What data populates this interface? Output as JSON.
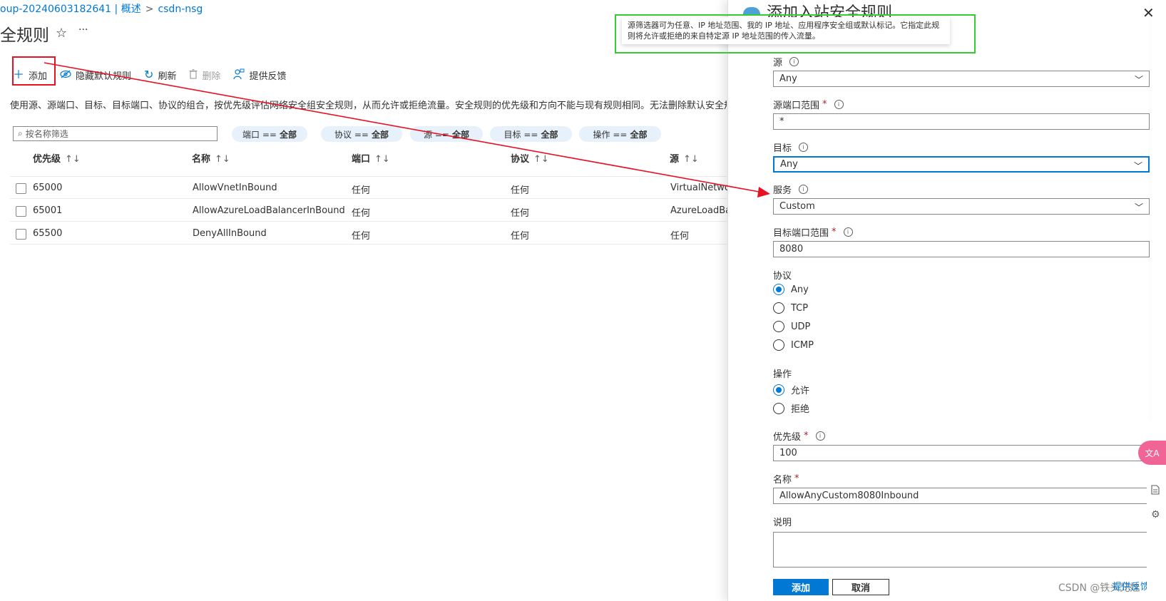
{
  "breadcrumb": {
    "part1": "oup-20240603182641 | 概述",
    "sep": ">",
    "part2": "csdn-nsg"
  },
  "page": {
    "title": "全规则",
    "star_icon": "☆",
    "more_icon": "···"
  },
  "toolbar": {
    "add": "添加",
    "hide_defaults": "隐藏默认规则",
    "refresh": "刷新",
    "delete": "删除",
    "feedback": "提供反馈"
  },
  "description": "使用源、源端口、目标、目标端口、协议的组合，按优先级评估网络安全组安全规则，从而允许或拒绝流量。安全规则的优先级和方向不能与现有规则相同。无法删除默认安全规则，但",
  "filter": {
    "placeholder": "按名称筛选",
    "pills": [
      {
        "key": "端口 ==",
        "value": "全部"
      },
      {
        "key": "协议 ==",
        "value": "全部"
      },
      {
        "key": "源 ==",
        "value": "全部"
      },
      {
        "key": "目标 ==",
        "value": "全部"
      },
      {
        "key": "操作 ==",
        "value": "全部"
      }
    ]
  },
  "table": {
    "sort_glyph": "↑↓",
    "columns": [
      "优先级",
      "名称",
      "端口",
      "协议",
      "源"
    ],
    "rows": [
      [
        "65000",
        "AllowVnetInBound",
        "任何",
        "任何",
        "VirtualNetwork"
      ],
      [
        "65001",
        "AllowAzureLoadBalancerInBound",
        "任何",
        "任何",
        "AzureLoadBalancer"
      ],
      [
        "65500",
        "DenyAllInBound",
        "任何",
        "任何",
        "任何"
      ]
    ]
  },
  "panel": {
    "title": "添加入站安全规则",
    "tooltip": "源筛选器可为任意、IP 地址范围、我的 IP 地址、应用程序安全组或默认标记。它指定此规则将允许或拒绝的来自特定源 IP 地址范围的传入流量。",
    "source_label": "源",
    "source_value": "Any",
    "source_port_label": "源端口范围",
    "source_port_value": "*",
    "dest_label": "目标",
    "dest_value": "Any",
    "service_label": "服务",
    "service_value": "Custom",
    "dest_port_label": "目标端口范围",
    "dest_port_value": "8080",
    "protocol_label": "协议",
    "protocol_options": [
      "Any",
      "TCP",
      "UDP",
      "ICMP"
    ],
    "protocol_selected": "Any",
    "action_label": "操作",
    "action_options": [
      "允许",
      "拒绝"
    ],
    "action_selected": "允许",
    "priority_label": "优先级",
    "priority_value": "100",
    "name_label": "名称",
    "name_value": "AllowAnyCustom8080Inbound",
    "desc_label": "说明",
    "required_mark": "*",
    "info_glyph": "i",
    "add_button": "添加",
    "cancel_button": "取消",
    "feedback": "提供反馈"
  },
  "watermark": "CSDN @铁头兄娃",
  "translate_badge": "文A"
}
